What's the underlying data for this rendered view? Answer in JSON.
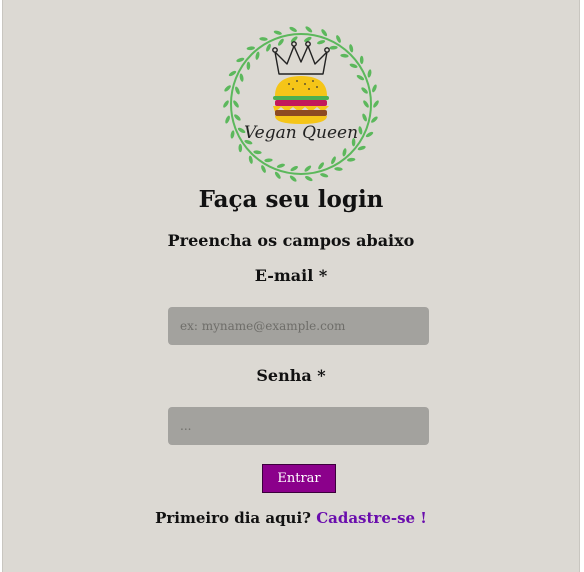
{
  "logo": {
    "text": "Vegan Queen",
    "icon": "burger-crown-logo",
    "wreath_color": "#5cb85c"
  },
  "login": {
    "title": "Faça seu login",
    "subtitle": "Preencha os campos abaixo",
    "email_label": "E-mail *",
    "email_placeholder": "ex: myname@example.com",
    "email_value": "",
    "password_label": "Senha *",
    "password_placeholder": "...",
    "password_value": "",
    "submit_label": "Entrar",
    "signup_prompt": "Primeiro dia aqui?",
    "signup_link": "Cadastre-se !"
  },
  "colors": {
    "background": "#dcd9d3",
    "input_bg": "#a3a29e",
    "button_bg": "#8b008b",
    "link": "#6a0dad"
  }
}
